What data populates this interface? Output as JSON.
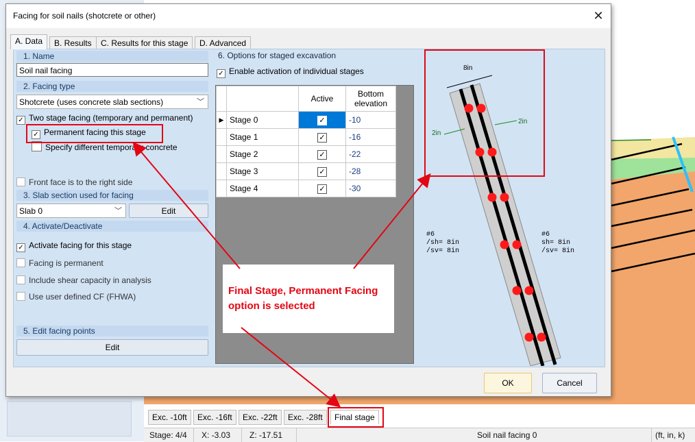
{
  "dialog": {
    "title": "Facing for soil nails (shotcrete or other)",
    "close_label": "✕",
    "tabs": [
      {
        "label": "A. Data"
      },
      {
        "label": "B. Results"
      },
      {
        "label": "C. Results for this stage"
      },
      {
        "label": "D. Advanced"
      }
    ],
    "ok_label": "OK",
    "cancel_label": "Cancel"
  },
  "left": {
    "name_section": "1. Name",
    "name_value": "Soil nail facing",
    "facing_type_section": "2. Facing type",
    "facing_type_value": "Shotcrete (uses concrete slab sections)",
    "two_stage_label": "Two stage facing (temporary and permanent)",
    "permanent_label": "Permanent facing this stage",
    "temp_concrete_label": "Specify different temporary concrete",
    "front_face_label": "Front face is to the right side",
    "slab_section": "3. Slab section used for facing",
    "slab_value": "Slab 0",
    "slab_edit": "Edit",
    "activate_section": "4. Activate/Deactivate",
    "activate_label": "Activate facing for this stage",
    "facing_permanent_label": "Facing is permanent",
    "shear_label": "Include shear capacity in analysis",
    "cf_label": "Use user defined CF (FHWA)",
    "edit_points_section": "5. Edit facing points",
    "edit_points_button": "Edit",
    "checks": {
      "two_stage": "✓",
      "permanent": "✓",
      "activate": "✓"
    }
  },
  "stages": {
    "section": "6. Options for staged excavation",
    "enable_label": "Enable activation of individual stages",
    "enable_check": "✓",
    "col_active": "Active",
    "col_bottom": "Bottom elevation",
    "row_marker": "▶",
    "check_mark": "✓",
    "rows": [
      {
        "name": "Stage 0",
        "elev": "-10"
      },
      {
        "name": "Stage 1",
        "elev": "-16"
      },
      {
        "name": "Stage 2",
        "elev": "-22"
      },
      {
        "name": "Stage 3",
        "elev": "-28"
      },
      {
        "name": "Stage 4",
        "elev": "-30"
      }
    ]
  },
  "preview": {
    "width_label": "8in",
    "left_cover": "2in",
    "right_cover": "2in",
    "left_bar": [
      "#6",
      "/sh= 8in",
      "/sv= 8in"
    ],
    "right_bar": [
      "#6",
      "sh= 8in",
      "/sv= 8in"
    ]
  },
  "annotation": {
    "callout": "Final Stage, Permanent Facing option is selected"
  },
  "app": {
    "stage_tabs": [
      "Exc. -10ft",
      "Exc. -16ft",
      "Exc. -22ft",
      "Exc. -28ft",
      "Final stage"
    ],
    "status": {
      "stage": "Stage: 4/4",
      "x": "X: -3.03",
      "z": "Z: -17.51",
      "object": "Soil nail facing 0",
      "units": "(ft, in, k)"
    }
  },
  "colors": {
    "annotation_red": "#e30613",
    "panel_blue": "#d2e3f4",
    "section_blue": "#c4d9ef",
    "selection_blue": "#0078d7",
    "rebar_red": "#ff1a1a"
  }
}
